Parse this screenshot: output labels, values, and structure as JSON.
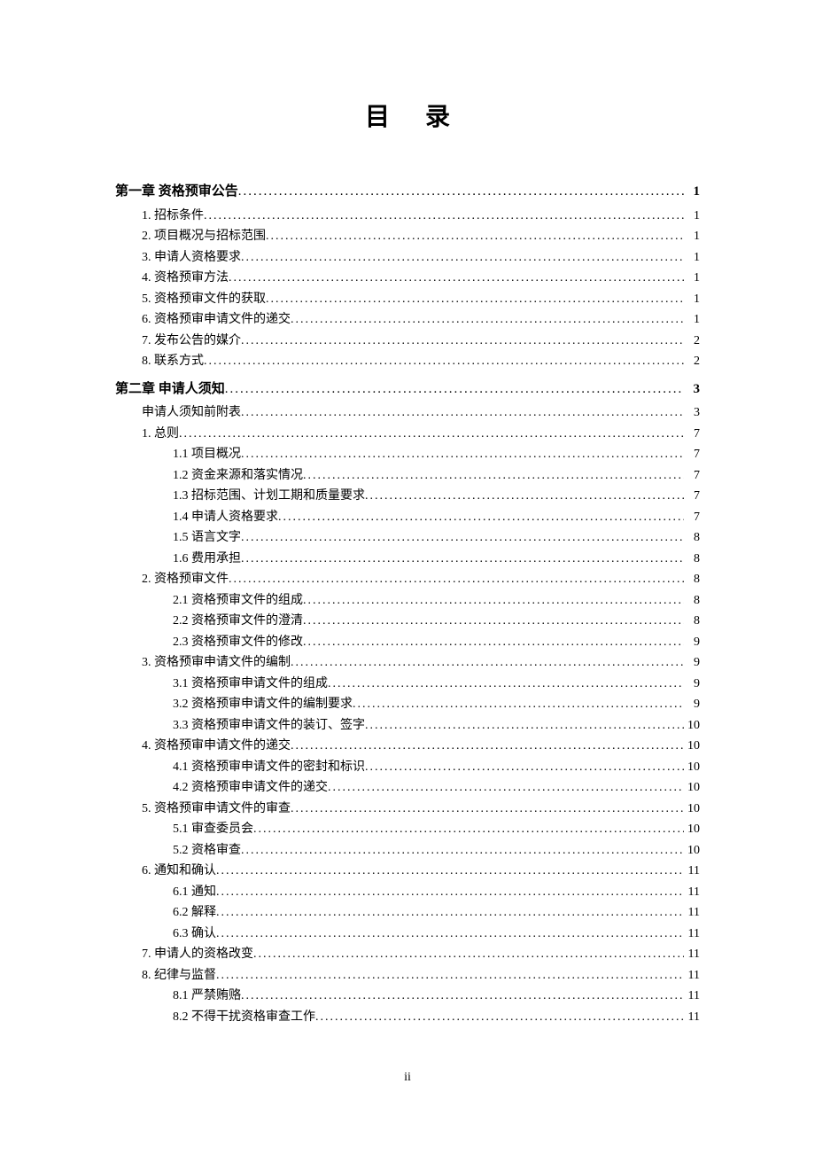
{
  "title": "目录",
  "page_number": "ii",
  "entries": [
    {
      "level": 1,
      "label": "第一章  资格预审公告",
      "page": "1"
    },
    {
      "level": 2,
      "label": "1.  招标条件",
      "page": "1"
    },
    {
      "level": 2,
      "label": "2.  项目概况与招标范围",
      "page": "1"
    },
    {
      "level": 2,
      "label": "3.  申请人资格要求",
      "page": "1"
    },
    {
      "level": 2,
      "label": "4.  资格预审方法",
      "page": "1"
    },
    {
      "level": 2,
      "label": "5.  资格预审文件的获取",
      "page": "1"
    },
    {
      "level": 2,
      "label": "6.  资格预审申请文件的递交",
      "page": "1"
    },
    {
      "level": 2,
      "label": "7.  发布公告的媒介",
      "page": "2"
    },
    {
      "level": 2,
      "label": "8.  联系方式",
      "page": "2"
    },
    {
      "level": 1,
      "label": "第二章  申请人须知",
      "page": "3"
    },
    {
      "level": 2,
      "label": "申请人须知前附表",
      "page": "3"
    },
    {
      "level": 2,
      "label": "1. 总则",
      "page": "7"
    },
    {
      "level": 3,
      "label": "1.1  项目概况",
      "page": "7"
    },
    {
      "level": 3,
      "label": "1.2  资金来源和落实情况",
      "page": "7"
    },
    {
      "level": 3,
      "label": "1.3  招标范围、计划工期和质量要求",
      "page": "7"
    },
    {
      "level": 3,
      "label": "1.4  申请人资格要求",
      "page": "7"
    },
    {
      "level": 3,
      "label": "1.5  语言文字",
      "page": "8"
    },
    {
      "level": 3,
      "label": "1.6  费用承担",
      "page": "8"
    },
    {
      "level": 2,
      "label": "2. 资格预审文件",
      "page": "8"
    },
    {
      "level": 3,
      "label": "2.1  资格预审文件的组成",
      "page": "8"
    },
    {
      "level": 3,
      "label": "2.2  资格预审文件的澄清",
      "page": "8"
    },
    {
      "level": 3,
      "label": "2.3  资格预审文件的修改",
      "page": "9"
    },
    {
      "level": 2,
      "label": "3. 资格预审申请文件的编制",
      "page": "9"
    },
    {
      "level": 3,
      "label": "3.1  资格预审申请文件的组成",
      "page": "9"
    },
    {
      "level": 3,
      "label": "3.2  资格预审申请文件的编制要求",
      "page": "9"
    },
    {
      "level": 3,
      "label": "3.3  资格预审申请文件的装订、签字",
      "page": "10"
    },
    {
      "level": 2,
      "label": "4. 资格预审申请文件的递交",
      "page": "10"
    },
    {
      "level": 3,
      "label": "4.1  资格预审申请文件的密封和标识",
      "page": "10"
    },
    {
      "level": 3,
      "label": "4.2  资格预审申请文件的递交",
      "page": "10"
    },
    {
      "level": 2,
      "label": "5. 资格预审申请文件的审查",
      "page": "10"
    },
    {
      "level": 3,
      "label": "5.1  审查委员会",
      "page": "10"
    },
    {
      "level": 3,
      "label": "5.2  资格审查",
      "page": "10"
    },
    {
      "level": 2,
      "label": "6. 通知和确认",
      "page": "11"
    },
    {
      "level": 3,
      "label": "6.1  通知",
      "page": "11"
    },
    {
      "level": 3,
      "label": "6.2  解释",
      "page": "11"
    },
    {
      "level": 3,
      "label": "6.3  确认",
      "page": "11"
    },
    {
      "level": 2,
      "label": "7. 申请人的资格改变",
      "page": "11"
    },
    {
      "level": 2,
      "label": "8. 纪律与监督",
      "page": "11"
    },
    {
      "level": 3,
      "label": "8.1  严禁贿赂",
      "page": "11"
    },
    {
      "level": 3,
      "label": "8.2  不得干扰资格审查工作",
      "page": "11"
    }
  ]
}
